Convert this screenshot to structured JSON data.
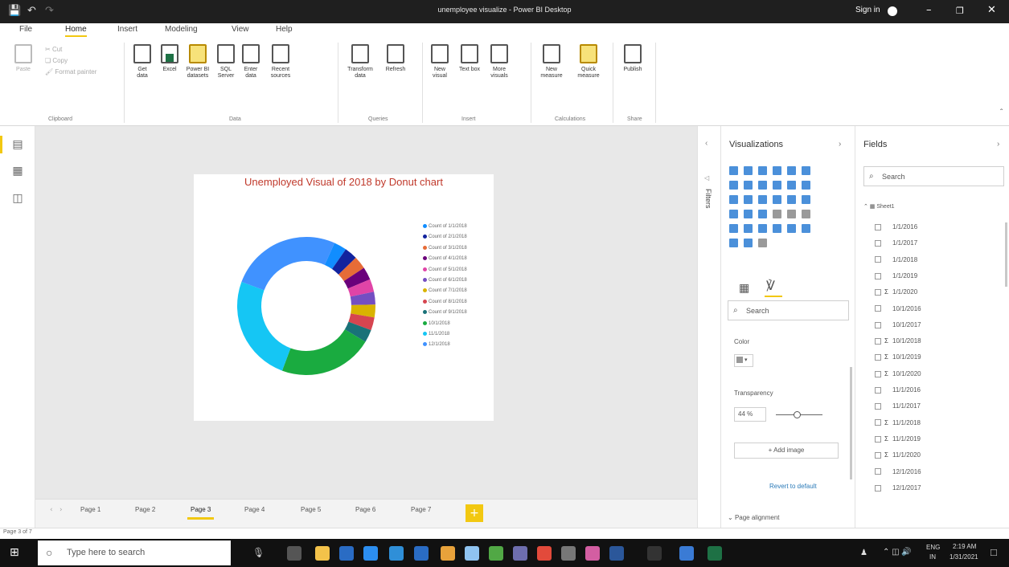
{
  "window": {
    "title": "unemployee visualize - Power BI Desktop",
    "sign_in": "Sign in"
  },
  "menu": [
    "File",
    "Home",
    "Insert",
    "Modeling",
    "View",
    "Help"
  ],
  "ribbon": {
    "clipboard": {
      "group": "Clipboard",
      "paste": "Paste",
      "cut": "Cut",
      "copy": "Copy",
      "format_painter": "Format painter"
    },
    "data": {
      "group": "Data",
      "get_data": "Get data",
      "excel": "Excel",
      "power_bi_datasets": "Power BI datasets",
      "sql_server": "SQL Server",
      "enter_data": "Enter data",
      "recent_sources": "Recent sources"
    },
    "queries": {
      "group": "Queries",
      "transform_data": "Transform data",
      "refresh": "Refresh"
    },
    "insert": {
      "group": "Insert",
      "new_visual": "New visual",
      "text_box": "Text box",
      "more_visuals": "More visuals"
    },
    "calculations": {
      "group": "Calculations",
      "new_measure": "New measure",
      "quick_measure": "Quick measure"
    },
    "share": {
      "group": "Share",
      "publish": "Publish"
    }
  },
  "visual": {
    "title": "Unemployed Visual of 2018 by Donut chart",
    "legend": [
      {
        "label": "Count of 1/1/2018",
        "color": "#118dff"
      },
      {
        "label": "Count of 2/1/2018",
        "color": "#12239e"
      },
      {
        "label": "Count of 3/1/2018",
        "color": "#e66c37"
      },
      {
        "label": "Count of 4/1/2018",
        "color": "#6b007b"
      },
      {
        "label": "Count of 5/1/2018",
        "color": "#e044a7"
      },
      {
        "label": "Count of 6/1/2018",
        "color": "#744ec2"
      },
      {
        "label": "Count of 7/1/2018",
        "color": "#d9b300"
      },
      {
        "label": "Count of 8/1/2018",
        "color": "#d64550"
      },
      {
        "label": "Count of 9/1/2018",
        "color": "#197278"
      },
      {
        "label": "10/1/2018",
        "color": "#1aab40"
      },
      {
        "label": "11/1/2018",
        "color": "#15c6f4"
      },
      {
        "label": "12/1/2018",
        "color": "#4092ff"
      }
    ],
    "slices": [
      {
        "value": 3,
        "color": "#118dff"
      },
      {
        "value": 3,
        "color": "#12239e"
      },
      {
        "value": 3,
        "color": "#e66c37"
      },
      {
        "value": 3,
        "color": "#6b007b"
      },
      {
        "value": 3,
        "color": "#e044a7"
      },
      {
        "value": 3,
        "color": "#744ec2"
      },
      {
        "value": 3,
        "color": "#d9b300"
      },
      {
        "value": 3,
        "color": "#d64550"
      },
      {
        "value": 3,
        "color": "#197278"
      },
      {
        "value": 22,
        "color": "#1aab40"
      },
      {
        "value": 25,
        "color": "#15c6f4"
      },
      {
        "value": 26,
        "color": "#4092ff"
      }
    ]
  },
  "pages": [
    "Page 1",
    "Page 2",
    "Page 3",
    "Page 4",
    "Page 5",
    "Page 6",
    "Page 7"
  ],
  "active_page": "Page 3",
  "status": "Page 3 of 7",
  "filters_label": "Filters",
  "viz": {
    "header": "Visualizations",
    "search_placeholder": "Search",
    "color_label": "Color",
    "transparency_label": "Transparency",
    "transparency_value": "44",
    "transparency_unit": "%",
    "transparency_level": 0.44,
    "add_image": "+ Add image",
    "revert": "Revert to default",
    "page_alignment": "Page alignment"
  },
  "fields": {
    "header": "Fields",
    "search_placeholder": "Search",
    "table": "Sheet1",
    "items": [
      {
        "label": "1/1/2016",
        "sigma": false
      },
      {
        "label": "1/1/2017",
        "sigma": false
      },
      {
        "label": "1/1/2018",
        "sigma": false
      },
      {
        "label": "1/1/2019",
        "sigma": false
      },
      {
        "label": "1/1/2020",
        "sigma": true
      },
      {
        "label": "10/1/2016",
        "sigma": false
      },
      {
        "label": "10/1/2017",
        "sigma": false
      },
      {
        "label": "10/1/2018",
        "sigma": true
      },
      {
        "label": "10/1/2019",
        "sigma": true
      },
      {
        "label": "10/1/2020",
        "sigma": true
      },
      {
        "label": "11/1/2016",
        "sigma": false
      },
      {
        "label": "11/1/2017",
        "sigma": false
      },
      {
        "label": "11/1/2018",
        "sigma": true
      },
      {
        "label": "11/1/2019",
        "sigma": true
      },
      {
        "label": "11/1/2020",
        "sigma": true
      },
      {
        "label": "12/1/2016",
        "sigma": false
      },
      {
        "label": "12/1/2017",
        "sigma": false
      }
    ]
  },
  "taskbar": {
    "search_placeholder": "Type here to search",
    "lang": "ENG",
    "region": "IN",
    "time": "2:19 AM",
    "date": "1/31/2021"
  }
}
